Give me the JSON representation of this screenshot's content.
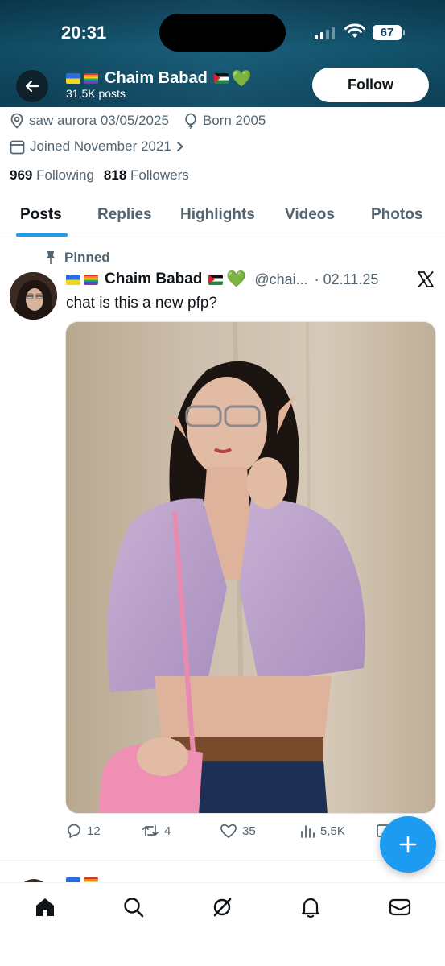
{
  "status_bar": {
    "time": "20:31",
    "battery": "67"
  },
  "header": {
    "name": "Chaim Babad",
    "posts_count": "31,5K posts",
    "follow_label": "Follow",
    "flags": [
      "ukraine-flag",
      "rainbow-flag"
    ],
    "suffix_emoji": [
      "palestine-flag",
      "green-heart"
    ]
  },
  "profile": {
    "location": "saw aurora 03/05/2025",
    "birth": "Born 2005",
    "joined": "Joined November 2021",
    "following_count": "969",
    "following_label": "Following",
    "followers_count": "818",
    "followers_label": "Followers"
  },
  "tabs": [
    {
      "label": "Posts",
      "active": true
    },
    {
      "label": "Replies",
      "active": false
    },
    {
      "label": "Highlights",
      "active": false
    },
    {
      "label": "Videos",
      "active": false
    },
    {
      "label": "Photos",
      "active": false
    }
  ],
  "post": {
    "pinned_label": "Pinned",
    "author": "Chaim Babad",
    "handle": "@chai...",
    "date": "· 02.11.25",
    "text": "chat is this a new pfp?",
    "stats": {
      "replies": "12",
      "reposts": "4",
      "likes": "35",
      "views": "5,5K"
    }
  },
  "colors": {
    "accent": "#1d9bf0",
    "header_bg": "#135a76",
    "muted_text": "#536471",
    "text": "#0f1419"
  },
  "bottom_nav": [
    "home-icon",
    "search-icon",
    "grok-icon",
    "notifications-icon",
    "messages-icon"
  ]
}
